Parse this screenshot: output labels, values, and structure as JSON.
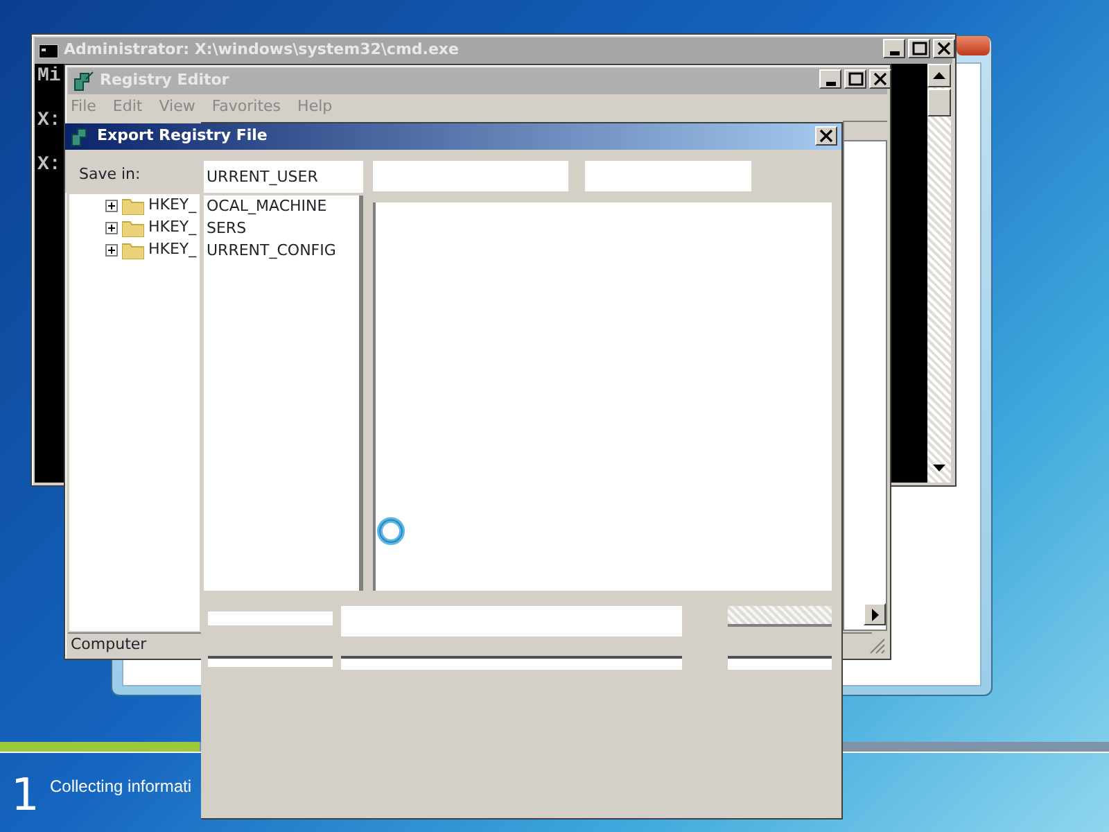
{
  "setup_window": {
    "progress": {
      "level": 0.18
    },
    "step_number": "1",
    "step_text": "Collecting informati"
  },
  "cmd_window": {
    "title": "Administrator: X:\\windows\\system32\\cmd.exe",
    "lines": [
      "Mi",
      "X:",
      "X:"
    ]
  },
  "registry_editor": {
    "title": "Registry Editor",
    "menu": [
      "File",
      "Edit",
      "View",
      "Favorites",
      "Help"
    ],
    "tree": [
      {
        "label": "HKEY_",
        "expanded": false
      },
      {
        "label": "HKEY_",
        "expanded": false
      },
      {
        "label": "HKEY_",
        "expanded": false
      }
    ],
    "status_bar": "Computer"
  },
  "export_dialog": {
    "title": "Export Registry File",
    "save_in_label": "Save in:",
    "save_in_value": "URRENT_USER",
    "list": [
      "OCAL_MACHINE",
      "SERS",
      "URRENT_CONFIG"
    ]
  }
}
